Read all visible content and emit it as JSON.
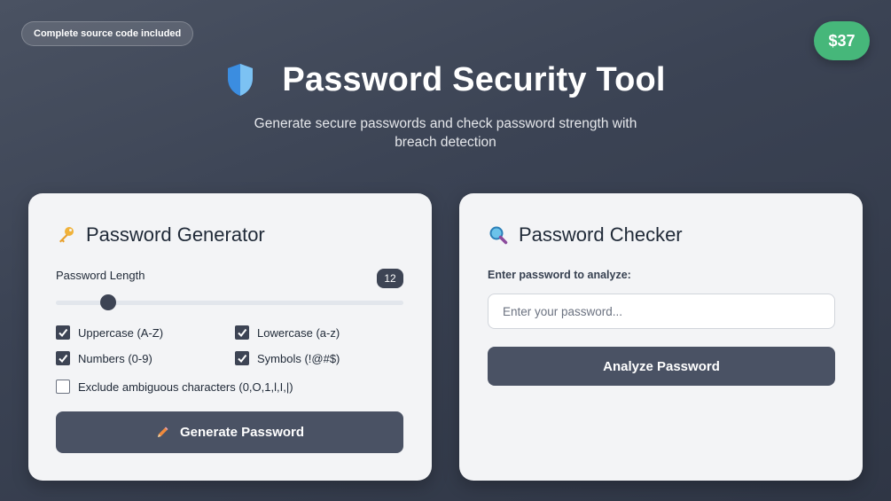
{
  "badge": "Complete source code included",
  "price": "$37",
  "hero": {
    "title": "Password Security Tool",
    "subtitle": "Generate secure passwords and check password strength with breach detection",
    "icon": "shield-icon"
  },
  "generator": {
    "title": "Password Generator",
    "icon": "key-icon",
    "length_label": "Password Length",
    "length_value": "12",
    "length_fraction": 0.15,
    "options": [
      {
        "label": "Uppercase (A-Z)",
        "checked": true
      },
      {
        "label": "Lowercase (a-z)",
        "checked": true
      },
      {
        "label": "Numbers (0-9)",
        "checked": true
      },
      {
        "label": "Symbols (!@#$)",
        "checked": true
      },
      {
        "label": "Exclude ambiguous characters (0,O,1,l,I,|)",
        "checked": false
      }
    ],
    "button_label": "Generate Password",
    "button_icon": "pencil-icon"
  },
  "checker": {
    "title": "Password Checker",
    "icon": "magnifier-icon",
    "input_label": "Enter password to analyze:",
    "input_value": "",
    "input_placeholder": "Enter your password...",
    "button_label": "Analyze Password"
  },
  "colors": {
    "accent": "#3d4454",
    "price_bg": "#46b77a",
    "button_bg": "#4a5264"
  }
}
